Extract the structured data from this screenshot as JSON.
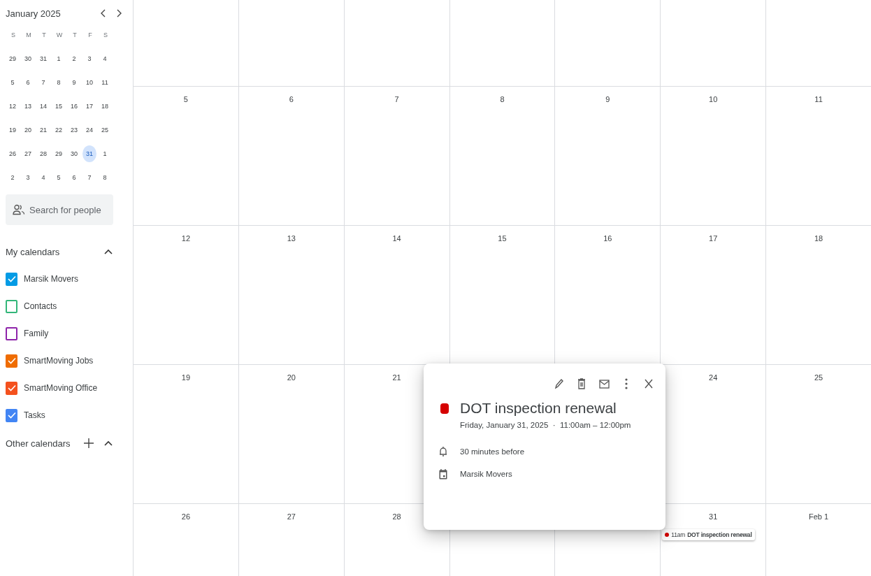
{
  "mini_calendar": {
    "title": "January 2025",
    "weekdays": [
      "S",
      "M",
      "T",
      "W",
      "T",
      "F",
      "S"
    ],
    "weeks": [
      [
        {
          "d": "29",
          "selected": false
        },
        {
          "d": "30",
          "selected": false
        },
        {
          "d": "31",
          "selected": false
        },
        {
          "d": "1",
          "selected": false
        },
        {
          "d": "2",
          "selected": false
        },
        {
          "d": "3",
          "selected": false
        },
        {
          "d": "4",
          "selected": false
        }
      ],
      [
        {
          "d": "5",
          "selected": false
        },
        {
          "d": "6",
          "selected": false
        },
        {
          "d": "7",
          "selected": false
        },
        {
          "d": "8",
          "selected": false
        },
        {
          "d": "9",
          "selected": false
        },
        {
          "d": "10",
          "selected": false
        },
        {
          "d": "11",
          "selected": false
        }
      ],
      [
        {
          "d": "12",
          "selected": false
        },
        {
          "d": "13",
          "selected": false
        },
        {
          "d": "14",
          "selected": false
        },
        {
          "d": "15",
          "selected": false
        },
        {
          "d": "16",
          "selected": false
        },
        {
          "d": "17",
          "selected": false
        },
        {
          "d": "18",
          "selected": false
        }
      ],
      [
        {
          "d": "19",
          "selected": false
        },
        {
          "d": "20",
          "selected": false
        },
        {
          "d": "21",
          "selected": false
        },
        {
          "d": "22",
          "selected": false
        },
        {
          "d": "23",
          "selected": false
        },
        {
          "d": "24",
          "selected": false
        },
        {
          "d": "25",
          "selected": false
        }
      ],
      [
        {
          "d": "26",
          "selected": false
        },
        {
          "d": "27",
          "selected": false
        },
        {
          "d": "28",
          "selected": false
        },
        {
          "d": "29",
          "selected": false
        },
        {
          "d": "30",
          "selected": false
        },
        {
          "d": "31",
          "selected": true
        },
        {
          "d": "1",
          "selected": false
        }
      ],
      [
        {
          "d": "2",
          "selected": false
        },
        {
          "d": "3",
          "selected": false
        },
        {
          "d": "4",
          "selected": false
        },
        {
          "d": "5",
          "selected": false
        },
        {
          "d": "6",
          "selected": false
        },
        {
          "d": "7",
          "selected": false
        },
        {
          "d": "8",
          "selected": false
        }
      ]
    ]
  },
  "search": {
    "placeholder": "Search for people"
  },
  "my_calendars": {
    "title": "My calendars",
    "expanded": true,
    "items": [
      {
        "label": "Marsik Movers",
        "checked": true,
        "color": "#039be5"
      },
      {
        "label": "Contacts",
        "checked": false,
        "color": "#33b679"
      },
      {
        "label": "Family",
        "checked": false,
        "color": "#8e24aa"
      },
      {
        "label": "SmartMoving Jobs",
        "checked": true,
        "color": "#ef6c00"
      },
      {
        "label": "SmartMoving Office",
        "checked": true,
        "color": "#f4511e"
      },
      {
        "label": "Tasks",
        "checked": true,
        "color": "#4285f4"
      }
    ]
  },
  "other_calendars": {
    "title": "Other calendars",
    "expanded": true
  },
  "month_grid": {
    "weeks": [
      {
        "dates": [
          "5",
          "6",
          "7",
          "8",
          "9",
          "10",
          "11"
        ]
      },
      {
        "dates": [
          "12",
          "13",
          "14",
          "15",
          "16",
          "17",
          "18"
        ]
      },
      {
        "dates": [
          "19",
          "20",
          "21"
        ],
        "dates_after_popup": [
          "24",
          "25"
        ]
      },
      {
        "dates": [
          "26",
          "27",
          "28"
        ],
        "dates_after_popup": [
          "31",
          "Feb 1"
        ]
      }
    ]
  },
  "event_chip": {
    "time": "11am",
    "title": "DOT inspection renewal",
    "color": "#d50000"
  },
  "event_popup": {
    "title": "DOT inspection renewal",
    "color": "#d50000",
    "when": "Friday, January 31, 2025  ·  11:00am – 12:00pm",
    "reminder": "30 minutes before",
    "calendar": "Marsik Movers"
  }
}
